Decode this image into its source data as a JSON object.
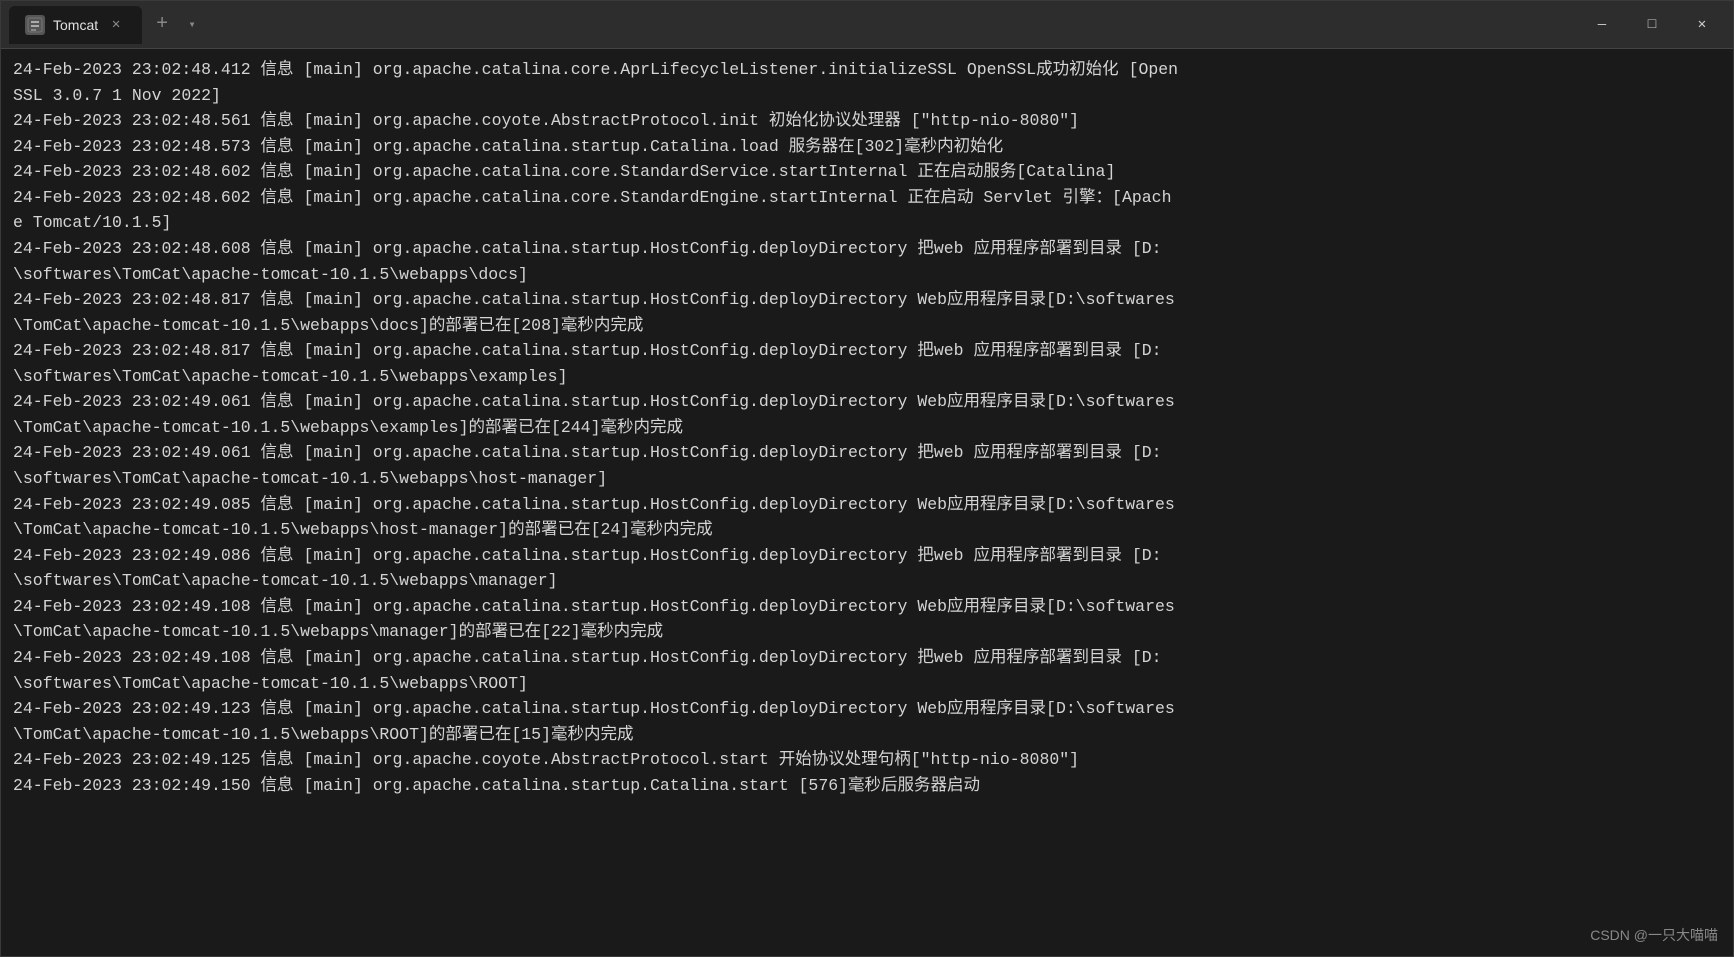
{
  "titlebar": {
    "tab_label": "Tomcat",
    "tab_icon_text": "⊡",
    "new_tab_label": "+",
    "dropdown_label": "▾",
    "close_label": "✕",
    "wc_minimize": "—",
    "wc_maximize": "□",
    "wc_close": "✕"
  },
  "terminal": {
    "lines": [
      "24-Feb-2023 23:02:48.412 信息 [main] org.apache.catalina.core.AprLifecycleListener.initializeSSL OpenSSL成功初始化 [Open",
      "SSL 3.0.7 1 Nov 2022]",
      "24-Feb-2023 23:02:48.561 信息 [main] org.apache.coyote.AbstractProtocol.init 初始化协议处理器 [\"http-nio-8080\"]",
      "24-Feb-2023 23:02:48.573 信息 [main] org.apache.catalina.startup.Catalina.load 服务器在[302]毫秒内初始化",
      "24-Feb-2023 23:02:48.602 信息 [main] org.apache.catalina.core.StandardService.startInternal 正在启动服务[Catalina]",
      "24-Feb-2023 23:02:48.602 信息 [main] org.apache.catalina.core.StandardEngine.startInternal 正在启动 Servlet 引擎：[Apach",
      "e Tomcat/10.1.5]",
      "24-Feb-2023 23:02:48.608 信息 [main] org.apache.catalina.startup.HostConfig.deployDirectory 把web 应用程序部署到目录 [D:",
      "\\softwares\\TomCat\\apache-tomcat-10.1.5\\webapps\\docs]",
      "24-Feb-2023 23:02:48.817 信息 [main] org.apache.catalina.startup.HostConfig.deployDirectory Web应用程序目录[D:\\softwares",
      "\\TomCat\\apache-tomcat-10.1.5\\webapps\\docs]的部署已在[208]毫秒内完成",
      "24-Feb-2023 23:02:48.817 信息 [main] org.apache.catalina.startup.HostConfig.deployDirectory 把web 应用程序部署到目录 [D:",
      "\\softwares\\TomCat\\apache-tomcat-10.1.5\\webapps\\examples]",
      "24-Feb-2023 23:02:49.061 信息 [main] org.apache.catalina.startup.HostConfig.deployDirectory Web应用程序目录[D:\\softwares",
      "\\TomCat\\apache-tomcat-10.1.5\\webapps\\examples]的部署已在[244]毫秒内完成",
      "24-Feb-2023 23:02:49.061 信息 [main] org.apache.catalina.startup.HostConfig.deployDirectory 把web 应用程序部署到目录 [D:",
      "\\softwares\\TomCat\\apache-tomcat-10.1.5\\webapps\\host-manager]",
      "24-Feb-2023 23:02:49.085 信息 [main] org.apache.catalina.startup.HostConfig.deployDirectory Web应用程序目录[D:\\softwares",
      "\\TomCat\\apache-tomcat-10.1.5\\webapps\\host-manager]的部署已在[24]毫秒内完成",
      "24-Feb-2023 23:02:49.086 信息 [main] org.apache.catalina.startup.HostConfig.deployDirectory 把web 应用程序部署到目录 [D:",
      "\\softwares\\TomCat\\apache-tomcat-10.1.5\\webapps\\manager]",
      "24-Feb-2023 23:02:49.108 信息 [main] org.apache.catalina.startup.HostConfig.deployDirectory Web应用程序目录[D:\\softwares",
      "\\TomCat\\apache-tomcat-10.1.5\\webapps\\manager]的部署已在[22]毫秒内完成",
      "24-Feb-2023 23:02:49.108 信息 [main] org.apache.catalina.startup.HostConfig.deployDirectory 把web 应用程序部署到目录 [D:",
      "\\softwares\\TomCat\\apache-tomcat-10.1.5\\webapps\\ROOT]",
      "24-Feb-2023 23:02:49.123 信息 [main] org.apache.catalina.startup.HostConfig.deployDirectory Web应用程序目录[D:\\softwares",
      "\\TomCat\\apache-tomcat-10.1.5\\webapps\\ROOT]的部署已在[15]毫秒内完成",
      "24-Feb-2023 23:02:49.125 信息 [main] org.apache.coyote.AbstractProtocol.start 开始协议处理句柄[\"http-nio-8080\"]",
      "24-Feb-2023 23:02:49.150 信息 [main] org.apache.catalina.startup.Catalina.start [576]毫秒后服务器启动"
    ]
  },
  "watermark": {
    "text": "CSDN @一只大喵喵"
  }
}
